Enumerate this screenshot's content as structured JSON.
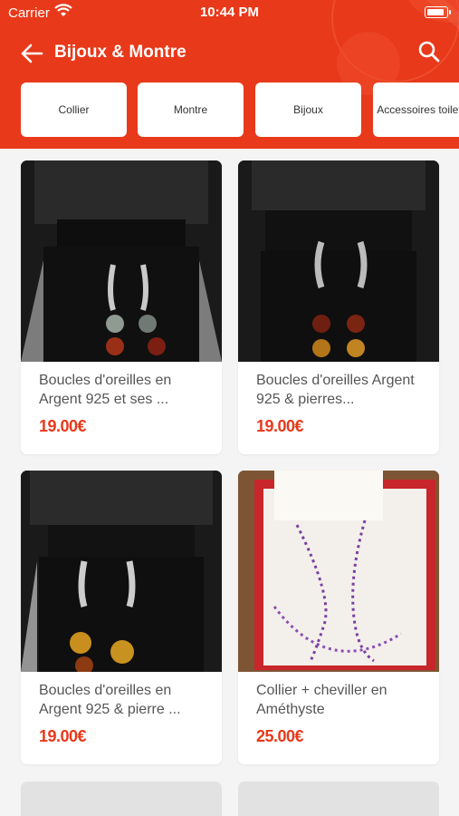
{
  "status_bar": {
    "carrier": "Carrier",
    "time": "10:44 PM"
  },
  "header": {
    "title": "Bijoux & Montre",
    "accent_color": "#e8391a"
  },
  "categories": [
    {
      "label": "Collier"
    },
    {
      "label": "Montre"
    },
    {
      "label": "Bijoux"
    },
    {
      "label": "Accessoires toilettes"
    }
  ],
  "products": [
    {
      "title": "Boucles d'oreilles en Argent 925 et ses ...",
      "price": "19.00€"
    },
    {
      "title": "Boucles d'oreilles Argent 925 & pierres...",
      "price": "19.00€"
    },
    {
      "title": "Boucles d'oreilles en Argent 925 & pierre ...",
      "price": "19.00€"
    },
    {
      "title": "Collier + cheviller en Améthyste",
      "price": "25.00€"
    }
  ],
  "icons": {
    "back": "arrow-left-icon",
    "search": "search-icon",
    "wifi": "wifi-icon",
    "battery": "battery-icon"
  }
}
